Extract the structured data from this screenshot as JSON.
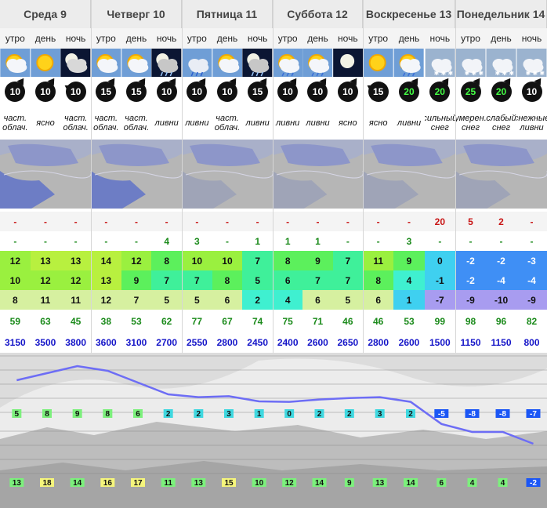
{
  "days": [
    {
      "label": "Среда 9"
    },
    {
      "label": "Четверг 10"
    },
    {
      "label": "Пятница 11"
    },
    {
      "label": "Суббота 12"
    },
    {
      "label": "Воскресенье 13"
    },
    {
      "label": "Понедельник 14"
    }
  ],
  "periods": [
    "утро",
    "день",
    "ночь",
    "утро",
    "день",
    "ночь",
    "утро",
    "день",
    "ночь",
    "утро",
    "день",
    "ночь",
    "утро",
    "день",
    "ночь",
    "утро",
    "день",
    "ночь"
  ],
  "weather_icons": [
    "partly-cloudy-day-icon",
    "sun-icon",
    "cloudy-night-icon",
    "partly-cloudy-day-icon",
    "partly-cloudy-day-icon",
    "showers-night-icon",
    "rain-day-icon",
    "partly-cloudy-day-icon",
    "showers-night-icon",
    "partly-cloudy-rain-icon",
    "partly-cloudy-rain-icon",
    "clear-night-icon",
    "sun-icon",
    "partly-cloudy-rain-icon",
    "snow-icon",
    "snow-icon",
    "snow-icon",
    "snow-icon"
  ],
  "wind": [
    {
      "speed": "10",
      "dir": "up"
    },
    {
      "speed": "10",
      "dir": "up"
    },
    {
      "speed": "10",
      "dir": "left"
    },
    {
      "speed": "15",
      "dir": "up"
    },
    {
      "speed": "15",
      "dir": "up"
    },
    {
      "speed": "10",
      "dir": "up"
    },
    {
      "speed": "10",
      "dir": "up"
    },
    {
      "speed": "10",
      "dir": "up"
    },
    {
      "speed": "15",
      "dir": "up"
    },
    {
      "speed": "10",
      "dir": "up"
    },
    {
      "speed": "10",
      "dir": "up"
    },
    {
      "speed": "10",
      "dir": "up"
    },
    {
      "speed": "15",
      "dir": "left"
    },
    {
      "speed": "20",
      "dir": "up",
      "highlight": true
    },
    {
      "speed": "20",
      "dir": "up",
      "highlight": true
    },
    {
      "speed": "25",
      "dir": "up",
      "highlight": true
    },
    {
      "speed": "20",
      "dir": "up",
      "highlight": true
    },
    {
      "speed": "10",
      "dir": "up"
    }
  ],
  "descriptions": [
    "част. облач.",
    "ясно",
    "част. облач.",
    "част. облач.",
    "част. облач.",
    "ливни",
    "ливни",
    "част. облач.",
    "ливни",
    "ливни",
    "ливни",
    "ясно",
    "ясно",
    "ливни",
    "сильный снег",
    "умерен. снег",
    "слабый снег",
    "снежные ливни"
  ],
  "rows": {
    "snow": [
      "-",
      "-",
      "-",
      "-",
      "-",
      "-",
      "-",
      "-",
      "-",
      "-",
      "-",
      "-",
      "-",
      "-",
      "20",
      "5",
      "2",
      "-"
    ],
    "rain": [
      "-",
      "-",
      "-",
      "-",
      "-",
      "4",
      "3",
      "-",
      "1",
      "1",
      "1",
      "-",
      "-",
      "3",
      "-",
      "-",
      "-",
      "-"
    ],
    "temp_top": [
      "12",
      "13",
      "13",
      "14",
      "12",
      "8",
      "10",
      "10",
      "7",
      "8",
      "9",
      "7",
      "11",
      "9",
      "0",
      "-2",
      "-2",
      "-3"
    ],
    "temp_mid": [
      "10",
      "12",
      "12",
      "13",
      "9",
      "7",
      "7",
      "8",
      "5",
      "6",
      "7",
      "7",
      "8",
      "4",
      "-1",
      "-2",
      "-4",
      "-4"
    ],
    "temp_low": [
      "8",
      "11",
      "11",
      "12",
      "7",
      "5",
      "5",
      "6",
      "2",
      "4",
      "6",
      "5",
      "6",
      "1",
      "-7",
      "-9",
      "-10",
      "-9"
    ],
    "humidity": [
      "59",
      "63",
      "45",
      "38",
      "53",
      "62",
      "77",
      "67",
      "74",
      "75",
      "71",
      "46",
      "46",
      "53",
      "99",
      "98",
      "96",
      "82"
    ],
    "freezing": [
      "3150",
      "3500",
      "3800",
      "3600",
      "3100",
      "2700",
      "2550",
      "2800",
      "2450",
      "2400",
      "2600",
      "2650",
      "2800",
      "2600",
      "1500",
      "1150",
      "1150",
      "800"
    ]
  },
  "chart_data": {
    "type": "line",
    "x": [
      "утро",
      "день",
      "ночь",
      "утро",
      "день",
      "ночь",
      "утро",
      "день",
      "ночь",
      "утро",
      "день",
      "ночь",
      "утро",
      "день",
      "ночь",
      "утро",
      "день",
      "ночь"
    ],
    "series": [
      {
        "values": [
          5,
          8,
          9,
          8,
          6,
          2,
          2,
          3,
          1,
          0,
          2,
          2,
          3,
          2,
          -5,
          -8,
          -8,
          -7
        ]
      },
      {
        "values": [
          13,
          18,
          14,
          16,
          17,
          11,
          13,
          15,
          10,
          12,
          14,
          9,
          13,
          14,
          6,
          4,
          4,
          -2
        ]
      }
    ],
    "curve": [
      7,
      8.5,
      10,
      9,
      6.5,
      4,
      3.4,
      3.6,
      2.5,
      2.4,
      2.9,
      3.2,
      3.4,
      2.4,
      -2.3,
      -4,
      -4,
      -6.5
    ],
    "colors": {
      "line": "#6d6df5",
      "warm": "#7cf07c",
      "hot": "#f5f57c",
      "cold": "#1b56f5"
    }
  }
}
